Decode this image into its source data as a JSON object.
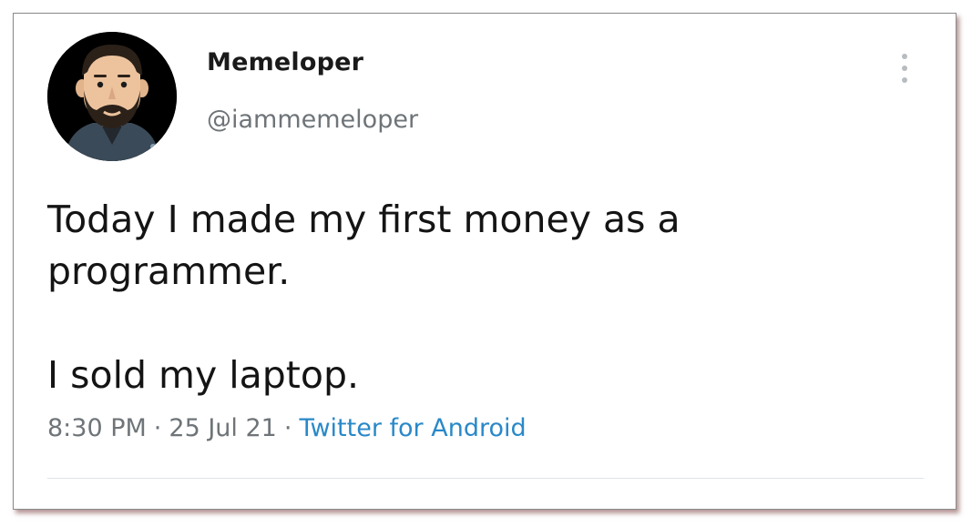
{
  "tweet": {
    "display_name": "Memeloper",
    "handle": "@iammemeloper",
    "text_line_1": "Today I made my first money as a",
    "text_line_2": "programmer.",
    "text_line_3": "I sold my laptop.",
    "time": "8:30 PM",
    "date": "25 Jul 21",
    "separator": "·",
    "source": "Twitter for Android"
  },
  "icons": {
    "more": "vertical-ellipsis-icon",
    "avatar": "bearded-man-avatar"
  },
  "colors": {
    "name": "#1a1a1a",
    "secondary": "#6e7478",
    "link": "#2a88c8",
    "divider": "#dfe3e6"
  }
}
